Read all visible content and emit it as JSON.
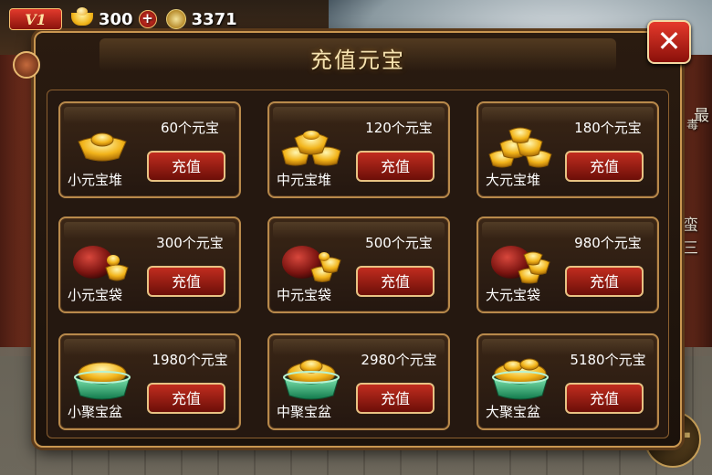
{
  "hud": {
    "vip_label": "V1",
    "gold_value": "300",
    "plus_symbol": "+",
    "coin_value": "3371"
  },
  "background": {
    "side_texts": [
      "最",
      "蛮三",
      "毒"
    ]
  },
  "panel": {
    "title": "充值元宝",
    "close_symbol": "✕"
  },
  "packages": [
    {
      "name": "小元宝堆",
      "amount": "60个元宝",
      "button": "充值",
      "icon": "small-ingot-pile-icon"
    },
    {
      "name": "中元宝堆",
      "amount": "120个元宝",
      "button": "充值",
      "icon": "medium-ingot-pile-icon"
    },
    {
      "name": "大元宝堆",
      "amount": "180个元宝",
      "button": "充值",
      "icon": "large-ingot-pile-icon"
    },
    {
      "name": "小元宝袋",
      "amount": "300个元宝",
      "button": "充值",
      "icon": "small-ingot-bag-icon"
    },
    {
      "name": "中元宝袋",
      "amount": "500个元宝",
      "button": "充值",
      "icon": "medium-ingot-bag-icon"
    },
    {
      "name": "大元宝袋",
      "amount": "980个元宝",
      "button": "充值",
      "icon": "large-ingot-bag-icon"
    },
    {
      "name": "小聚宝盆",
      "amount": "1980个元宝",
      "button": "充值",
      "icon": "small-treasure-bowl-icon"
    },
    {
      "name": "中聚宝盆",
      "amount": "2980个元宝",
      "button": "充值",
      "icon": "medium-treasure-bowl-icon"
    },
    {
      "name": "大聚宝盆",
      "amount": "5180个元宝",
      "button": "充值",
      "icon": "large-treasure-bowl-icon"
    }
  ],
  "colors": {
    "accent_gold": "#c99650",
    "button_red": "#c12d1f",
    "panel_bg": "#1b120b"
  }
}
